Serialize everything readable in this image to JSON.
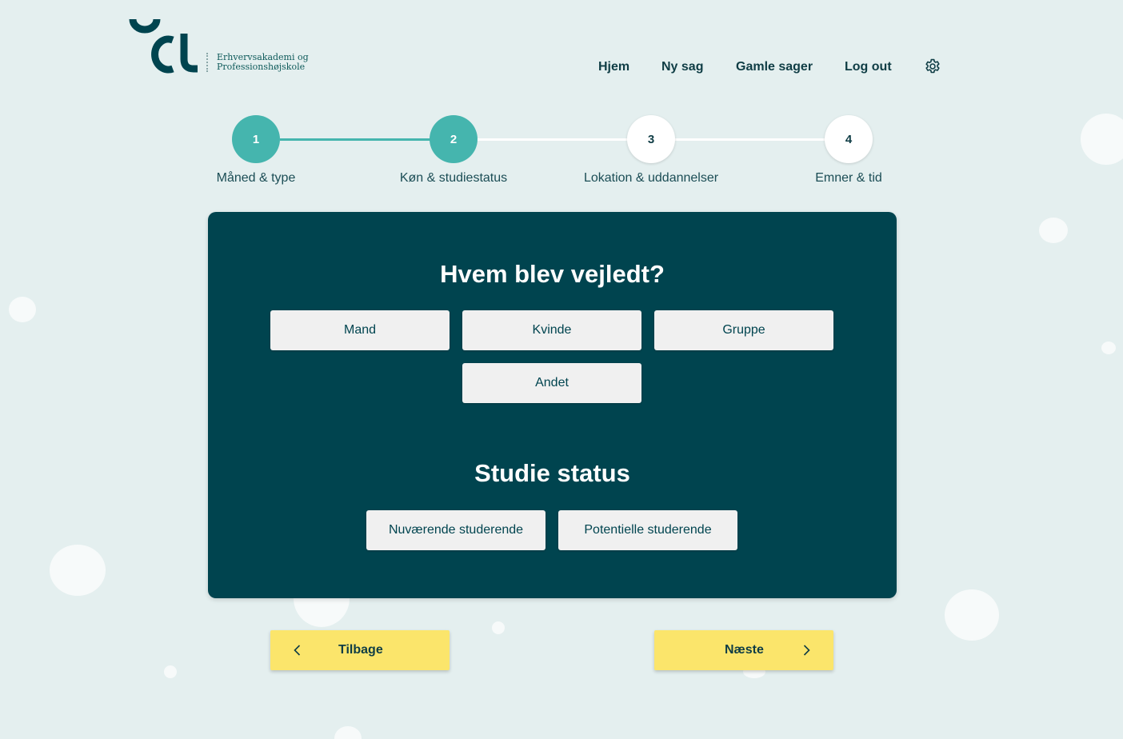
{
  "header": {
    "logo_line1": "Erhvervsakademi og",
    "logo_line2": "Professionshøjskole",
    "nav": {
      "home": "Hjem",
      "new_case": "Ny sag",
      "old_cases": "Gamle sager",
      "logout": "Log out"
    },
    "settings_icon": "gear-icon"
  },
  "stepper": {
    "current_step": 2,
    "steps": [
      {
        "number": "1",
        "label": "Måned & type",
        "state": "done"
      },
      {
        "number": "2",
        "label": "Køn & studiestatus",
        "state": "done"
      },
      {
        "number": "3",
        "label": "Lokation & uddannelser",
        "state": "todo"
      },
      {
        "number": "4",
        "label": "Emner & tid",
        "state": "todo"
      }
    ]
  },
  "form": {
    "gender_title": "Hvem blev vejledt?",
    "gender_options": [
      "Mand",
      "Kvinde",
      "Gruppe",
      "Andet"
    ],
    "status_title": "Studie status",
    "status_options": [
      "Nuværende studerende",
      "Potentielle studerende"
    ]
  },
  "footer_nav": {
    "back_label": "Tilbage",
    "next_label": "Næste"
  },
  "colors": {
    "background": "#e4efef",
    "card": "#00444f",
    "accent_teal": "#45b5ae",
    "button_yellow": "#fbe56b",
    "option_bg": "#f0f0f0"
  }
}
